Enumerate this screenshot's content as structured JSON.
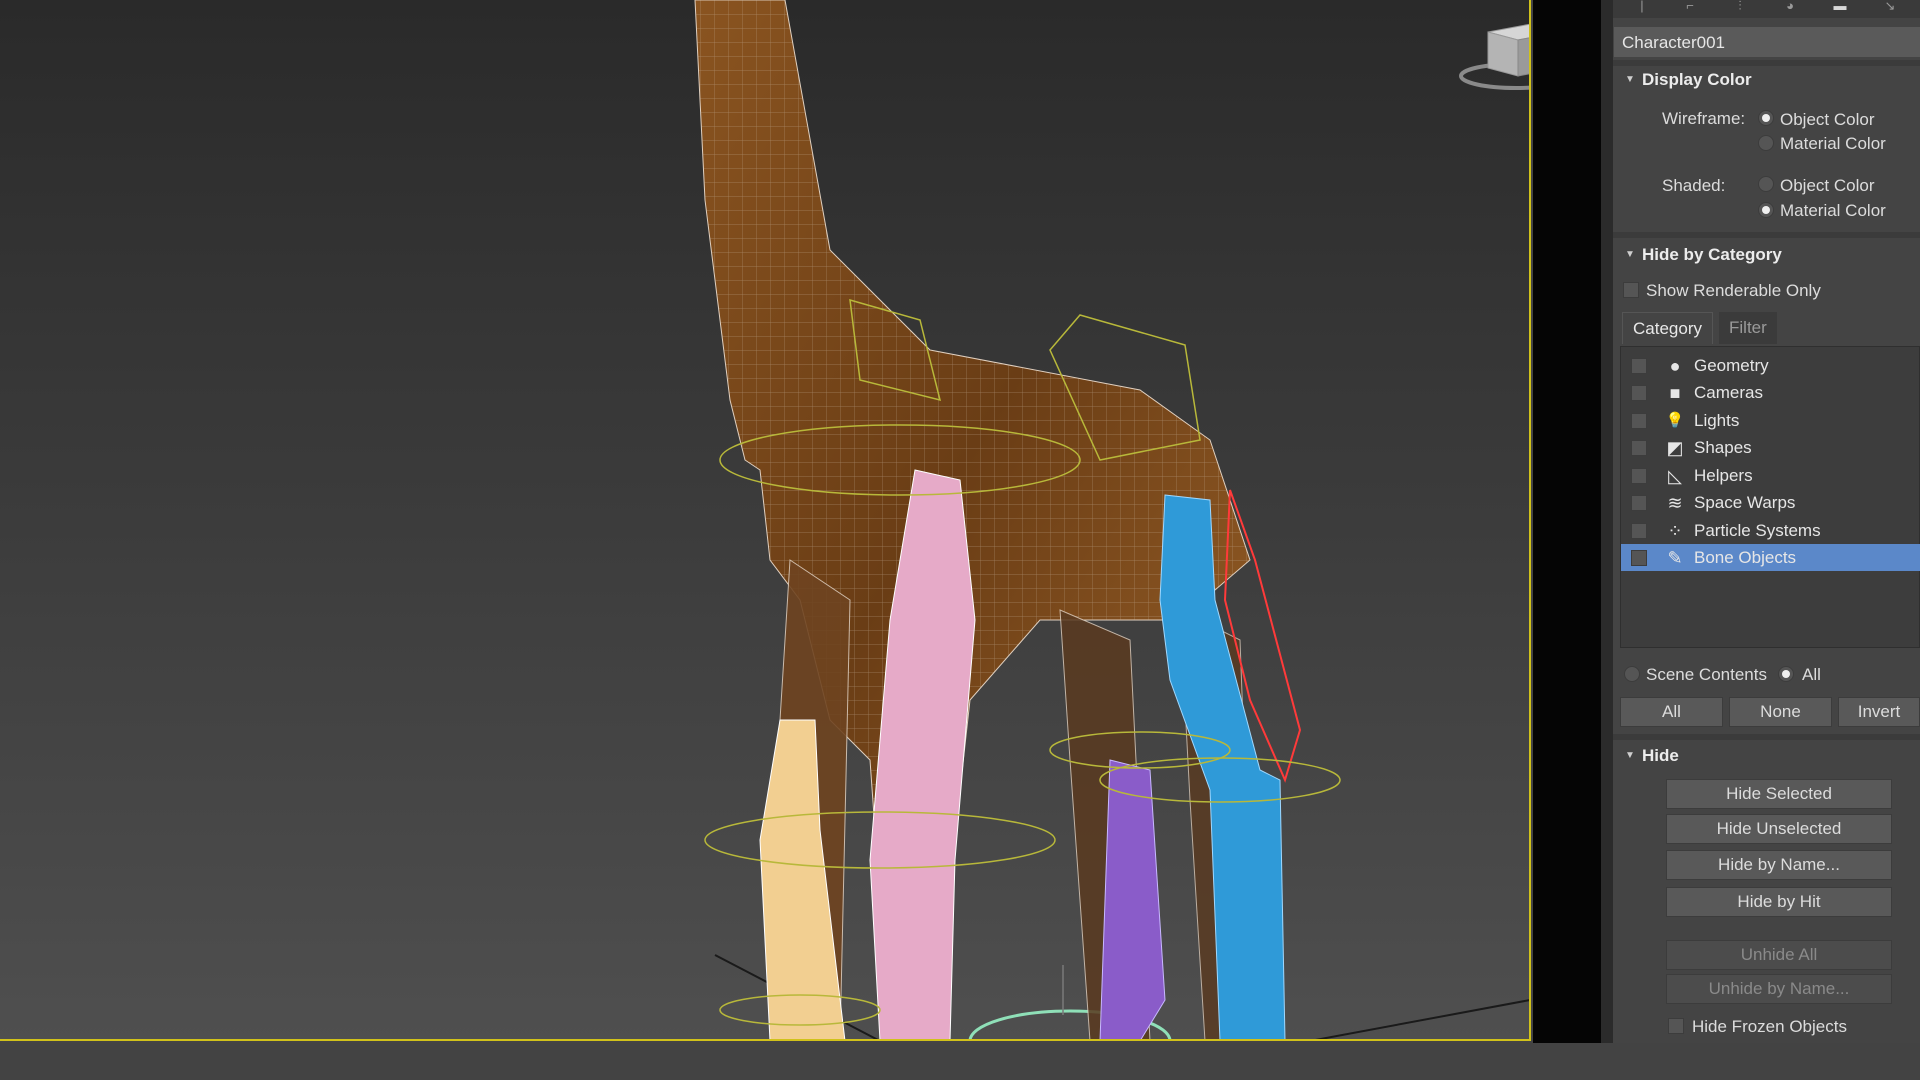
{
  "toolbar": {
    "icons": [
      "create-icon",
      "modify-icon",
      "hierarchy-icon",
      "motion-icon",
      "display-icon",
      "utilities-icon"
    ]
  },
  "object_name": "Character001",
  "display_color": {
    "title": "Display Color",
    "wireframe_label": "Wireframe:",
    "shaded_label": "Shaded:",
    "object_color": "Object Color",
    "material_color": "Material Color",
    "wireframe_selected": "Object Color",
    "shaded_selected": "Material Color"
  },
  "hide_by_category": {
    "title": "Hide by Category",
    "show_renderable_only": "Show Renderable Only",
    "tabs": [
      {
        "label": "Category"
      },
      {
        "label": "Filter"
      }
    ],
    "items": [
      {
        "label": "Geometry",
        "icon": "geometry-icon",
        "glyph": "●"
      },
      {
        "label": "Cameras",
        "icon": "camera-icon",
        "glyph": "■"
      },
      {
        "label": "Lights",
        "icon": "light-icon",
        "glyph": "💡"
      },
      {
        "label": "Shapes",
        "icon": "shapes-icon",
        "glyph": "◩"
      },
      {
        "label": "Helpers",
        "icon": "helpers-icon",
        "glyph": "◺"
      },
      {
        "label": "Space Warps",
        "icon": "space-warps-icon",
        "glyph": "≋"
      },
      {
        "label": "Particle Systems",
        "icon": "particle-systems-icon",
        "glyph": "⁘"
      },
      {
        "label": "Bone Objects",
        "icon": "bone-objects-icon",
        "glyph": "✎"
      }
    ],
    "selected_item": "Bone Objects",
    "scene_contents": "Scene Contents",
    "all_radio": "All",
    "btn_all": "All",
    "btn_none": "None",
    "btn_invert": "Invert"
  },
  "hide": {
    "title": "Hide",
    "hide_selected": "Hide Selected",
    "hide_unselected": "Hide Unselected",
    "hide_by_name": "Hide by Name...",
    "hide_by_hit": "Hide by Hit",
    "unhide_all": "Unhide All",
    "unhide_by_name": "Unhide by Name...",
    "hide_frozen_objects": "Hide Frozen Objects"
  },
  "colors": {
    "viewport_border": "#d1c21a",
    "selection": "#5b88c9",
    "bone_blue": "#2f9ad8",
    "bone_pink": "#e6aac8",
    "bone_tan": "#f2cf91",
    "bone_purple": "#8a5cc9",
    "giraffe_brown": "#7a4a1e"
  }
}
